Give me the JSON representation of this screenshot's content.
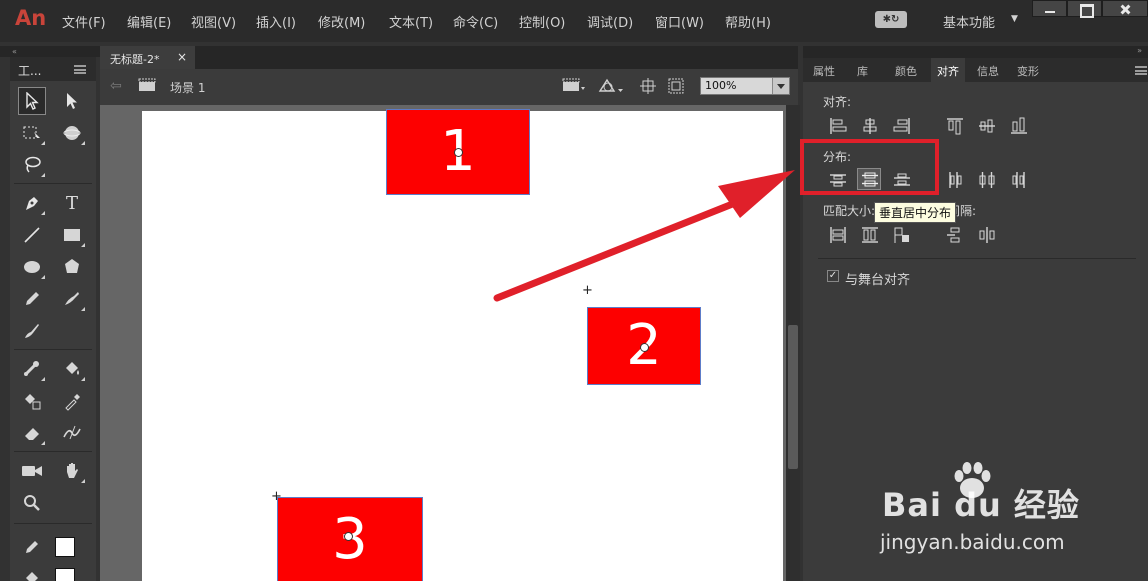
{
  "app": {
    "logo": "An"
  },
  "menubar": {
    "items": [
      "文件(F)",
      "编辑(E)",
      "视图(V)",
      "插入(I)",
      "修改(M)",
      "文本(T)",
      "命令(C)",
      "控制(O)",
      "调试(D)",
      "窗口(W)",
      "帮助(H)"
    ],
    "workspace": "基本功能",
    "sync_label": "✱↻"
  },
  "tools_panel": {
    "collapse": "«",
    "title": "工..."
  },
  "document": {
    "tab_title": "无标题-2*",
    "tab_close": "×",
    "scene_label": "场景 1",
    "zoom": "100%"
  },
  "stage": {
    "rectangles": [
      {
        "label": "1"
      },
      {
        "label": "2"
      },
      {
        "label": "3"
      }
    ],
    "fill_color": "#fd0000",
    "reg_marks": [
      "+",
      "+"
    ]
  },
  "panel": {
    "collapse": "»",
    "tabs": [
      "属性",
      "库",
      "颜色",
      "对齐",
      "信息",
      "变形"
    ],
    "active_tab": "对齐",
    "align_label": "对齐:",
    "distribute_label": "分布:",
    "match_size_label": "匹配大小:",
    "space_label": "间隔:",
    "stage_align_checked": "✓",
    "stage_align_label": "与舞台对齐",
    "tooltip": "垂直居中分布"
  },
  "annotation": {
    "color": "#e0202a"
  },
  "watermark": {
    "brand": "Bai du 经验",
    "url": "jingyan.baidu.com"
  }
}
